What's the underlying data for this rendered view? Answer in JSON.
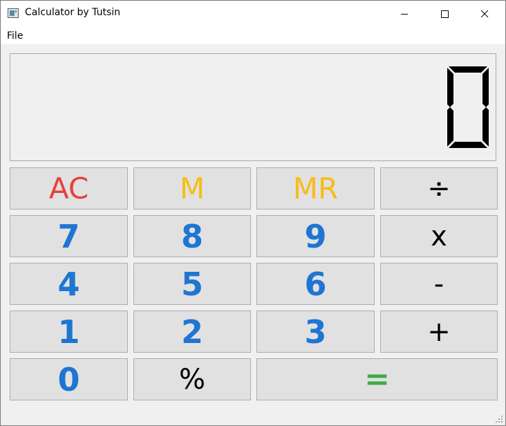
{
  "window": {
    "title": "Calculator by Tutsin"
  },
  "menu": {
    "file_label": "File"
  },
  "display": {
    "value": "0"
  },
  "buttons": {
    "clear": "AC",
    "memory": "M",
    "memory_recall": "MR",
    "divide": "÷",
    "seven": "7",
    "eight": "8",
    "nine": "9",
    "multiply": "x",
    "four": "4",
    "five": "5",
    "six": "6",
    "subtract": "-",
    "one": "1",
    "two": "2",
    "three": "3",
    "add": "+",
    "zero": "0",
    "percent": "%",
    "equals": "="
  },
  "colors": {
    "clear": "#e8413c",
    "memory": "#f7bd16",
    "digits": "#1e75d2",
    "operators": "#000000",
    "equals": "#3dab4a"
  },
  "icons": [
    "app-icon",
    "minimize-icon",
    "maximize-icon",
    "close-icon",
    "size-grip-icon"
  ]
}
